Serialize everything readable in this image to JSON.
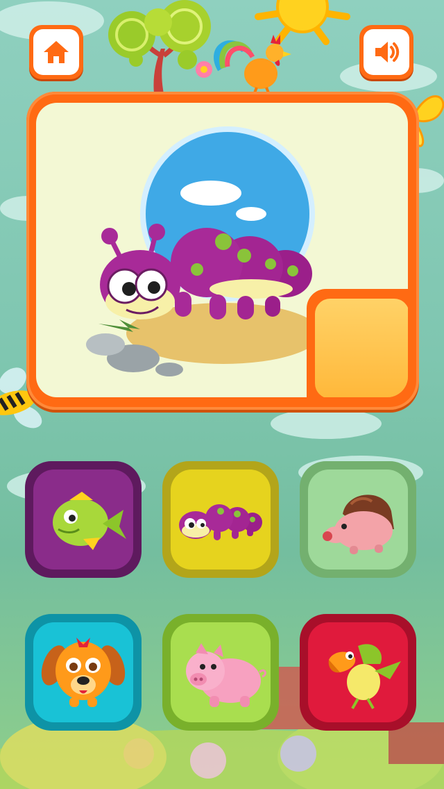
{
  "header": {
    "home_icon": "home-icon",
    "sound_icon": "speaker-icon"
  },
  "puzzle": {
    "subject": "caterpillar",
    "missing_piece": "bottom-right"
  },
  "choices": [
    {
      "animal": "fish",
      "color": "#8a2c8a"
    },
    {
      "animal": "caterpillar",
      "color": "#e6d31e"
    },
    {
      "animal": "hedgehog",
      "color": "#9ed99a"
    },
    {
      "animal": "dog",
      "color": "#19c2d6"
    },
    {
      "animal": "pig",
      "color": "#a9de4f"
    },
    {
      "animal": "parrot",
      "color": "#e01a3c"
    }
  ]
}
